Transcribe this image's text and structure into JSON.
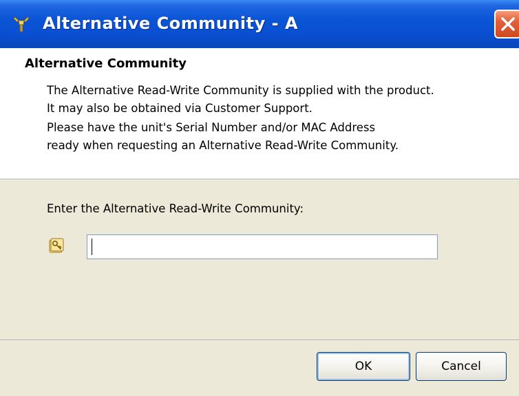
{
  "window": {
    "title": "Alternative Community - A"
  },
  "header": {
    "title": "Alternative Community",
    "description_lines": [
      "The Alternative Read-Write Community is supplied with the product.",
      "It may also be obtained via Customer Support.",
      "Please have the unit's Serial Number and/or MAC Address",
      "ready when requesting an Alternative Read-Write Community."
    ]
  },
  "form": {
    "prompt": "Enter the Alternative Read-Write Community:",
    "community_value": "",
    "icon": "key-icon"
  },
  "buttons": {
    "ok_label": "OK",
    "cancel_label": "Cancel"
  },
  "colors": {
    "titlebar": "#0a54d6",
    "close_button": "#e2603a",
    "dialog_background": "#ece9d8"
  }
}
